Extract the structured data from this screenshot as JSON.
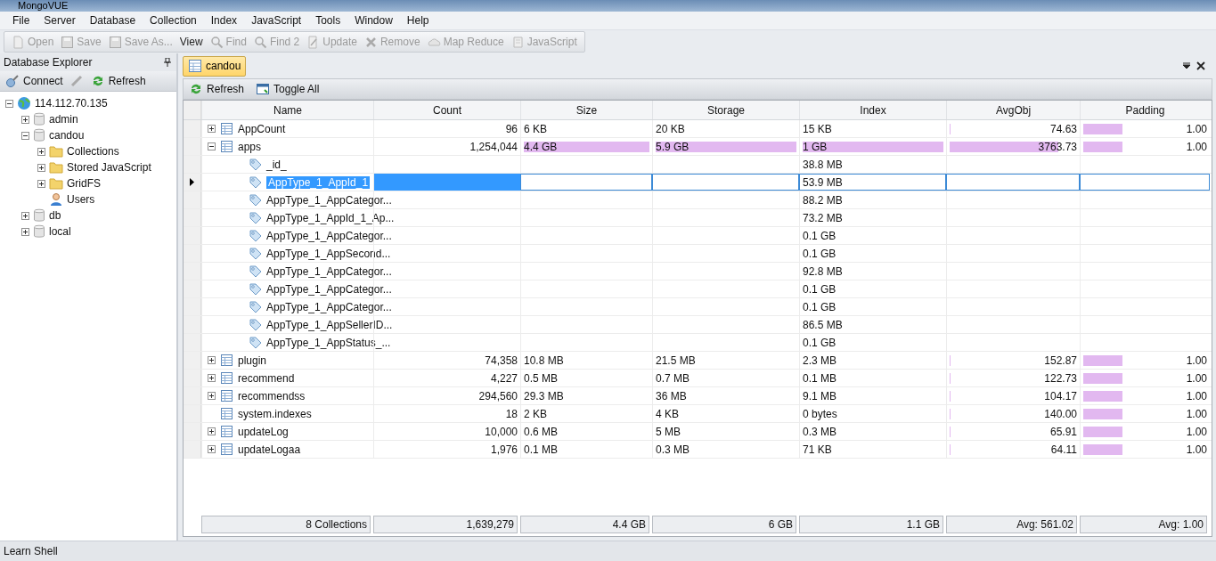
{
  "window": {
    "title": "MongoVUE"
  },
  "menu": [
    "File",
    "Server",
    "Database",
    "Collection",
    "Index",
    "JavaScript",
    "Tools",
    "Window",
    "Help"
  ],
  "toolbar": [
    {
      "label": "Open",
      "kind": "open",
      "disabled": true
    },
    {
      "label": "Save",
      "kind": "save",
      "disabled": true
    },
    {
      "label": "Save As...",
      "kind": "save",
      "disabled": true
    },
    {
      "label": "View",
      "kind": "text",
      "disabled": false
    },
    {
      "label": "Find",
      "kind": "find",
      "disabled": true
    },
    {
      "label": "Find 2",
      "kind": "find",
      "disabled": true
    },
    {
      "label": "Update",
      "kind": "update",
      "disabled": true
    },
    {
      "label": "Remove",
      "kind": "remove",
      "disabled": true
    },
    {
      "label": "Map Reduce",
      "kind": "mapreduce",
      "disabled": true
    },
    {
      "label": "JavaScript",
      "kind": "script",
      "disabled": true
    }
  ],
  "sidebar": {
    "title": "Database Explorer",
    "buttons": [
      {
        "label": "Connect",
        "kind": "connect"
      },
      {
        "label": "Refresh",
        "kind": "refresh"
      }
    ],
    "tree": [
      {
        "label": "114.112.70.135",
        "kind": "server",
        "expanded": true,
        "children": [
          {
            "label": "admin",
            "kind": "database",
            "expanded": false
          },
          {
            "label": "candou",
            "kind": "database",
            "expanded": true,
            "children": [
              {
                "label": "Collections",
                "kind": "folder",
                "expanded": false
              },
              {
                "label": "Stored JavaScript",
                "kind": "folder",
                "expanded": false
              },
              {
                "label": "GridFS",
                "kind": "folder",
                "expanded": false
              },
              {
                "label": "Users",
                "kind": "user"
              }
            ]
          },
          {
            "label": "db",
            "kind": "database",
            "expanded": false
          },
          {
            "label": "local",
            "kind": "database",
            "expanded": false
          }
        ]
      }
    ]
  },
  "tabs": [
    {
      "label": "candou",
      "selected": true
    }
  ],
  "grid_toolbar": [
    {
      "label": "Refresh",
      "kind": "refresh"
    },
    {
      "label": "Toggle All",
      "kind": "toggle"
    }
  ],
  "table": {
    "columns": [
      "Name",
      "Count",
      "Size",
      "Storage",
      "Index",
      "AvgObj",
      "Padding"
    ],
    "rows": [
      {
        "kind": "collection",
        "name": "AppCount",
        "expanded": false,
        "selected": false,
        "cells": [
          {
            "text": "96"
          },
          {
            "text": "6 KB"
          },
          {
            "text": "20 KB"
          },
          {
            "text": "15 KB"
          },
          {
            "text": "74.63",
            "level": 0.01
          },
          {
            "text": "1.00",
            "level": 0.3
          }
        ]
      },
      {
        "kind": "collection",
        "name": "apps",
        "expanded": true,
        "selected": false,
        "cells": [
          {
            "text": "1,254,044"
          },
          {
            "text": "4.4 GB",
            "level": 1
          },
          {
            "text": "5.9 GB",
            "level": 1
          },
          {
            "text": "1 GB",
            "level": 1
          },
          {
            "text": "3763.73",
            "level": 0.82
          },
          {
            "text": "1.00",
            "level": 0.3
          }
        ],
        "children": [
          {
            "name": "_id_",
            "index": "38.8 MB",
            "selected": false
          },
          {
            "name": "AppType_1_AppId_1",
            "index": "53.9 MB",
            "selected": true
          },
          {
            "name": "AppType_1_AppCategor...",
            "index": "88.2 MB",
            "selected": false
          },
          {
            "name": "AppType_1_AppId_1_Ap...",
            "index": "73.2 MB",
            "selected": false
          },
          {
            "name": "AppType_1_AppCategor...",
            "index": "0.1 GB",
            "selected": false
          },
          {
            "name": "AppType_1_AppSecond...",
            "index": "0.1 GB",
            "selected": false
          },
          {
            "name": "AppType_1_AppCategor...",
            "index": "92.8 MB",
            "selected": false
          },
          {
            "name": "AppType_1_AppCategor...",
            "index": "0.1 GB",
            "selected": false
          },
          {
            "name": "AppType_1_AppCategor...",
            "index": "0.1 GB",
            "selected": false
          },
          {
            "name": "AppType_1_AppSellerID...",
            "index": "86.5 MB",
            "selected": false
          },
          {
            "name": "AppType_1_AppStatus_...",
            "index": "0.1 GB",
            "selected": false
          }
        ]
      },
      {
        "kind": "collection",
        "name": "plugin",
        "expanded": false,
        "selected": false,
        "cells": [
          {
            "text": "74,358"
          },
          {
            "text": "10.8 MB"
          },
          {
            "text": "21.5 MB"
          },
          {
            "text": "2.3 MB"
          },
          {
            "text": "152.87",
            "level": 0.01
          },
          {
            "text": "1.00",
            "level": 0.3
          }
        ]
      },
      {
        "kind": "collection",
        "name": "recommend",
        "expanded": false,
        "selected": false,
        "cells": [
          {
            "text": "4,227"
          },
          {
            "text": "0.5 MB"
          },
          {
            "text": "0.7 MB"
          },
          {
            "text": "0.1 MB"
          },
          {
            "text": "122.73",
            "level": 0.01
          },
          {
            "text": "1.00",
            "level": 0.3
          }
        ]
      },
      {
        "kind": "collection",
        "name": "recommendss",
        "expanded": false,
        "selected": false,
        "cells": [
          {
            "text": "294,560"
          },
          {
            "text": "29.3 MB"
          },
          {
            "text": "36 MB"
          },
          {
            "text": "9.1 MB"
          },
          {
            "text": "104.17",
            "level": 0.01
          },
          {
            "text": "1.00",
            "level": 0.3
          }
        ]
      },
      {
        "kind": "plain",
        "name": "system.indexes",
        "selected": false,
        "cells": [
          {
            "text": "18"
          },
          {
            "text": "2 KB"
          },
          {
            "text": "4 KB"
          },
          {
            "text": "0 bytes"
          },
          {
            "text": "140.00",
            "level": 0.01
          },
          {
            "text": "1.00",
            "level": 0.3
          }
        ]
      },
      {
        "kind": "collection",
        "name": "updateLog",
        "expanded": false,
        "selected": false,
        "cells": [
          {
            "text": "10,000"
          },
          {
            "text": "0.6 MB"
          },
          {
            "text": "5 MB"
          },
          {
            "text": "0.3 MB"
          },
          {
            "text": "65.91",
            "level": 0.01
          },
          {
            "text": "1.00",
            "level": 0.3
          }
        ]
      },
      {
        "kind": "collection",
        "name": "updateLogaa",
        "expanded": false,
        "selected": false,
        "cells": [
          {
            "text": "1,976"
          },
          {
            "text": "0.1 MB"
          },
          {
            "text": "0.3 MB"
          },
          {
            "text": "71 KB"
          },
          {
            "text": "64.11",
            "level": 0.01
          },
          {
            "text": "1.00",
            "level": 0.3
          }
        ]
      }
    ],
    "totals": [
      "8 Collections",
      "1,639,279",
      "4.4 GB",
      "6 GB",
      "1.1 GB",
      "Avg: 561.02",
      "Avg: 1.00"
    ]
  },
  "status_bar": {
    "text": "Learn Shell"
  }
}
